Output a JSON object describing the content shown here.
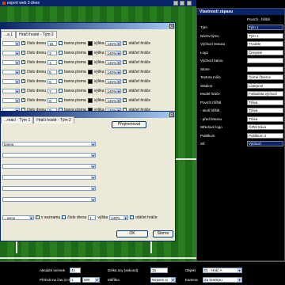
{
  "app_bar": {
    "title": "export web 3 dnes"
  },
  "back_window": {
    "tabs": [
      "...a 1",
      "Hráči hosté - Tým 2"
    ],
    "rows": [
      {
        "number": "15",
        "colors": "barva písma",
        "size": "140%",
        "label": "otáčet hráče"
      },
      {
        "number": "2",
        "colors": "barva písma",
        "size": "140%",
        "label": "otáčet hráče"
      },
      {
        "number": "4",
        "colors": "barva písma",
        "size": "140%",
        "label": "otáčet hráče"
      },
      {
        "number": "5",
        "colors": "barva písma",
        "size": "140%",
        "label": "otáčet hráče"
      },
      {
        "number": "6",
        "colors": "barva písma",
        "size": "140%",
        "label": "otáčet hráče"
      },
      {
        "number": "7",
        "colors": "barva písma",
        "size": "140%",
        "label": "otáčet hráče"
      },
      {
        "number": "8",
        "colors": "barva písma",
        "size": "140%",
        "label": "otáčet hráče"
      },
      {
        "number": "9",
        "colors": "barva písma",
        "size": "140%",
        "label": "otáčet hráče"
      }
    ],
    "number_label": "číslo dresu",
    "size_label": "výška"
  },
  "front_window": {
    "tabs": [
      "...mácí - Tým 1",
      "Hráči hosté - Tým 2"
    ],
    "rename_button": "Přejmenovat",
    "select1": "kanea",
    "bottom_row": {
      "selected": "...ivece",
      "in_list": "v seznamu",
      "number_label": "číslo dresu",
      "number": "1",
      "size_label": "výška",
      "size": "140%",
      "rotate": "otáčet hráče"
    },
    "ok": "OK",
    "cancel": "Storno"
  },
  "right_panel": {
    "title": "Vlastnosti zápasu",
    "header": "Povrch - hřiště",
    "rows": [
      {
        "label": "Tým",
        "value": "Tým 1",
        "highlight": true
      },
      {
        "label": "Název týmu",
        "value": "Tým 1"
      },
      {
        "label": "Výchozí textura",
        "value": "Trouble"
      },
      {
        "label": "Logo",
        "value": "Červené"
      },
      {
        "label": "Výchozí barvu",
        "value": ""
      },
      {
        "label": "Stúne",
        "value": ""
      },
      {
        "label": "Textura míče",
        "value": "Černé čtverce"
      },
      {
        "label": "Stadion",
        "value": "Liverpool"
      },
      {
        "label": "Model hráče",
        "value": "Fotbalista výchozí"
      },
      {
        "label": "Povrch hřiště",
        "value": "Tráva"
      },
      {
        "label": "- okolí hřiště",
        "value": "Tráva"
      },
      {
        "label": "- před branou",
        "value": "Tráva"
      },
      {
        "label": "Středové logo",
        "value": "ČZMi tráva"
      },
      {
        "label": "Publikum",
        "value": "Publikum 2"
      },
      {
        "label": "Síť",
        "value": "Výchozí",
        "highlight": true
      }
    ]
  },
  "bottom_bar": {
    "aktualni_label": "Aktuální snímek",
    "aktualni_value": "41",
    "prehrat_label": "Přehrát na čas (s:ms)",
    "prehrat_a": "1",
    "prehrat_b": "500",
    "delka_label": "Délka scy (sekund)",
    "delka_value": "15",
    "meritko_label": "Měřítko",
    "meritko_value": "Nejsem si",
    "objekt_label": "Objekt",
    "objekt_value": "01 - Hráč A",
    "kamera_label": "Kamera",
    "kamera_value": "Za brankou"
  }
}
